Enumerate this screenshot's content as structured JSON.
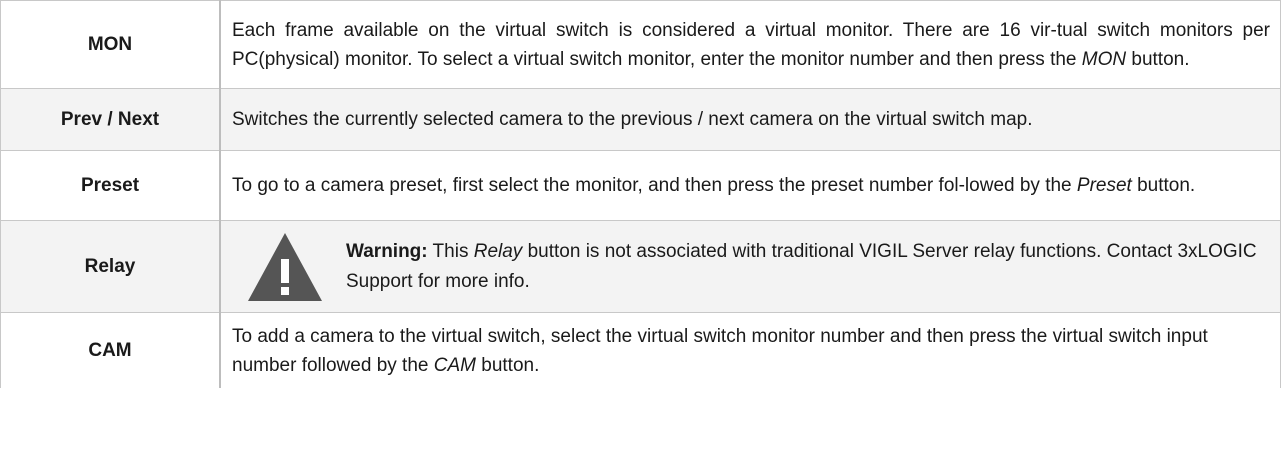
{
  "rows": [
    {
      "term": "MON",
      "desc": {
        "part1": "Each frame available on the virtual switch is considered a virtual monitor. There are 16 vir-tual switch monitors per PC(physical) monitor. To select a virtual switch monitor, enter the monitor number and then press the ",
        "em": "MON",
        "part2": " button."
      }
    },
    {
      "term": "Prev / Next",
      "desc": {
        "part1": "Switches the currently selected camera to the previous / next camera on the virtual switch map."
      }
    },
    {
      "term": "Preset",
      "desc": {
        "part1": "To go to a camera preset, first select the monitor, and then press the preset number fol-lowed by the ",
        "em": "Preset",
        "part2": " button."
      }
    },
    {
      "term": "Relay",
      "warning": {
        "icon": "warning-triangle-icon",
        "label": "Warning:",
        "part1": " This ",
        "em": "Relay",
        "part2": " button is not associated with traditional VIGIL Server relay functions. Contact 3xLOGIC Support for more info.",
        "icon_color": "#555555"
      }
    },
    {
      "term": "CAM",
      "desc": {
        "part1": "To add a camera to the virtual switch, select the virtual switch monitor number and then press the virtual switch input number followed by the ",
        "em": "CAM",
        "part2": " button."
      }
    }
  ]
}
